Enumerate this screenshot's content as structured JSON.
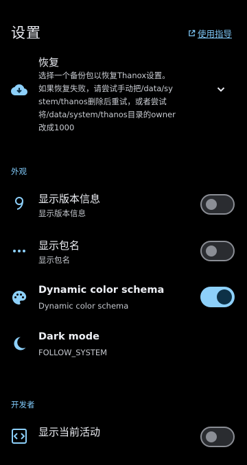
{
  "header": {
    "title": "设置",
    "guide_link": "使用指导"
  },
  "restore": {
    "title": "恢复",
    "description": "选择一个备份包以恢复Thanox设置。如果恢复失败，请尝试手动把/data/system/thanos删除后重试，或者尝试将/data/system/thanos目录的owner改成1000",
    "icon": "cloud-download-icon"
  },
  "sections": {
    "appearance": "外观",
    "developer": "开发者"
  },
  "appearance_items": [
    {
      "title": "显示版本信息",
      "summary": "显示版本信息",
      "icon": "nine-icon",
      "enabled": false
    },
    {
      "title": "显示包名",
      "summary": "显示包名",
      "icon": "more-horizontal-icon",
      "enabled": false
    },
    {
      "title": "Dynamic color schema",
      "summary": "Dynamic color schema",
      "icon": "palette-icon",
      "enabled": true
    },
    {
      "title": "Dark mode",
      "summary": "FOLLOW_SYSTEM",
      "icon": "moon-icon"
    }
  ],
  "developer_items": [
    {
      "title": "显示当前活动",
      "icon": "code-icon",
      "enabled": false
    }
  ],
  "colors": {
    "accent": "#7fc8f8",
    "background": "#000000",
    "switch_on": "#8dd0fa"
  }
}
